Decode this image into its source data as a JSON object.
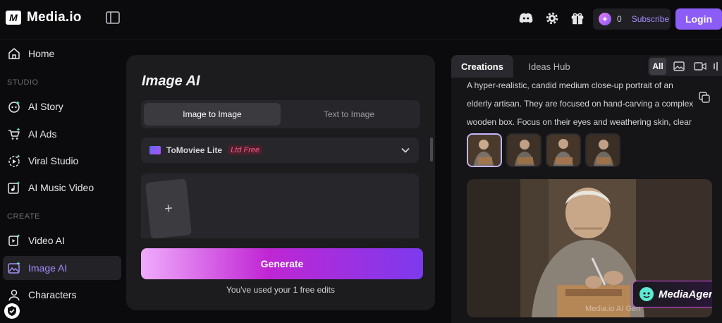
{
  "header": {
    "brand": "Media.io",
    "credit_count": "0",
    "subscribe_label": "Subscribe",
    "login_label": "Login"
  },
  "sidebar": {
    "home": "Home",
    "studio_label": "STUDIO",
    "studio_items": [
      "AI Story",
      "AI Ads",
      "Viral Studio",
      "AI Music Video"
    ],
    "create_label": "CREATE",
    "create_items": [
      "Video AI",
      "Image AI",
      "Characters"
    ],
    "active_item": "Image AI"
  },
  "panel": {
    "title": "Image AI",
    "tabs": [
      "Image to Image",
      "Text to Image"
    ],
    "active_tab": "Image to Image",
    "model": {
      "name": "ToMoviee Lite",
      "badge": "Ltd Free"
    },
    "upload_symbol": "+",
    "generate_label": "Generate",
    "usage_note": "You've used your 1 free edits"
  },
  "right": {
    "tabs": [
      "Creations",
      "Ideas Hub"
    ],
    "active_tab": "Creations",
    "filter_all": "All",
    "prompt": "A hyper-realistic, candid medium close-up portrait of an elderly artisan. They are focused on hand-carving a complex wooden box. Focus on their eyes and weathering skin, clear texture on…",
    "agent_badge": "MediaAgent",
    "watermark": "Media.io AI Gen"
  },
  "colors": {
    "accent": "#8b5cf6",
    "active_nav": "#a78bfa",
    "badge_pink": "#ff5c8a"
  },
  "icons": {
    "sidebar_toggle": "sidebar-toggle-icon",
    "discord": "discord-icon",
    "settings": "gear-icon",
    "gift": "gift-icon"
  }
}
